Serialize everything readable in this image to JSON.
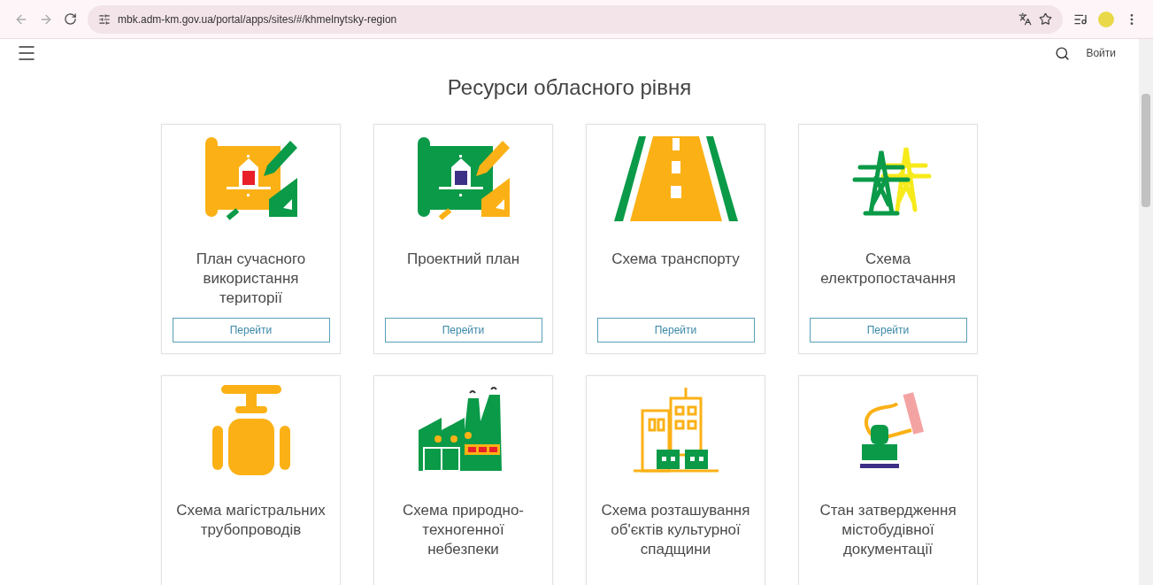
{
  "browser": {
    "url": "mbk.adm-km.gov.ua/portal/apps/sites/#/khmelnytsky-region"
  },
  "header": {
    "login": "Войти"
  },
  "title": "Ресурси обласного рівня",
  "cards": [
    {
      "title": "План сучасного використання території",
      "button": "Перейти"
    },
    {
      "title": "Проектний план",
      "button": "Перейти"
    },
    {
      "title": "Схема транспорту",
      "button": "Перейти"
    },
    {
      "title": "Схема електропостачання",
      "button": "Перейти"
    },
    {
      "title": "Схема магістральних трубопроводів"
    },
    {
      "title": "Схема природно-техногенної небезпеки"
    },
    {
      "title": "Схема розташування об'єктів культурної спадщини"
    },
    {
      "title": "Стан затвердження містобудівної документації"
    }
  ]
}
